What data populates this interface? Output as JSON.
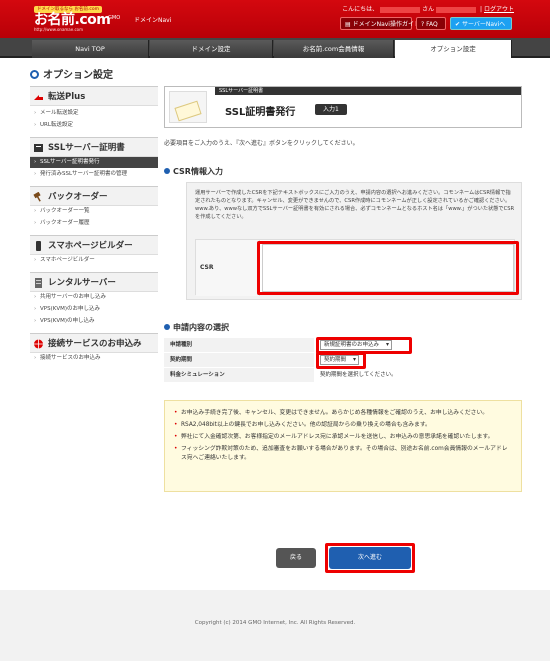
{
  "header": {
    "logo_tag": "ドメイン取るなら お名前.com",
    "logo_text": "お名前.com",
    "logo_url": "http://www.onamae.com",
    "gmo_label": "GMO",
    "site_name": "ドメインNavi",
    "greeting_prefix": "こんにちは、",
    "greeting_suffix": "さん",
    "logout": "ログアウト",
    "guide_button": "ドメインNavi操作ガイド",
    "faq_button": "FAQ",
    "twitter_button": "サーバーNaviへ"
  },
  "tabs": [
    {
      "label": "Navi TOP",
      "active": false
    },
    {
      "label": "ドメイン設定",
      "active": false
    },
    {
      "label": "お名前.com会員情報",
      "active": false
    },
    {
      "label": "オプション設定",
      "active": true
    }
  ],
  "page_title": "オプション設定",
  "sidebar": {
    "sections": [
      {
        "title": "転送Plus",
        "icon": "arrow-icon",
        "items": [
          "メール転送設定",
          "URL転送設定"
        ]
      },
      {
        "title": "SSLサーバー証明書",
        "icon": "ssl-icon",
        "items": [
          "SSLサーバー証明書発行",
          "発行済みSSLサーバー証明書の管理"
        ]
      },
      {
        "title": "バックオーダー",
        "icon": "gavel-icon",
        "items": [
          "バックオーダー一覧",
          "バックオーダー履歴"
        ]
      },
      {
        "title": "スマホページビルダー",
        "icon": "smartphone-icon",
        "items": [
          "スマホページビルダー"
        ]
      },
      {
        "title": "レンタルサーバー",
        "icon": "server-icon",
        "items": [
          "共用サーバーのお申し込み",
          "VPS(KVM)のお申し込み",
          "VPS(KVM)の申し込み"
        ]
      },
      {
        "title": "接続サービスのお申込み",
        "icon": "globe-icon",
        "items": [
          "接続サービスのお申込み"
        ]
      }
    ]
  },
  "banner": {
    "category": "SSLサーバー証明書",
    "title": "SSL証明書発行",
    "step_badge": "入力1"
  },
  "intro": "必要項目をご入力のうえ、『次へ進む』ボタンをクリックしてください。",
  "csr": {
    "section_title": "CSR情報入力",
    "description": "運用サーバーで作成したCSRを下記テキストボックスにご入力のうえ、申請内容の選択へお進みください。コモンネームはCSR情報で指定されたものとなります。キャンセル、変更ができませんので、CSR作成時にコモンネームが正しく設定されているかご確認ください。www.あり、wwwなし双方でSSLサーバー証明書を有効にされる場合、必ずコモンネームとなるホスト名は「www.」がついた状態でCSRを作成してください。",
    "field_label": "CSR",
    "textarea_value": ""
  },
  "application": {
    "section_title": "申請内容の選択",
    "rows": [
      {
        "label": "申請種別",
        "value": "新規証明書のお申込み",
        "type": "select"
      },
      {
        "label": "契約期間",
        "value": "契約期間",
        "type": "select"
      },
      {
        "label": "料金シミュレーション",
        "value": "契約期間を選択してください。",
        "type": "text"
      }
    ]
  },
  "notices": [
    "お申込み手続き完了後、キャンセル、変更はできません。あらかじめ各種情報をご確認のうえ、お申し込みください。",
    "RSA2,048bit以上の鍵長でお申し込みください。他の認証局からの乗り換えの場合も含みます。",
    "弊社にて入金確認次第、お客様指定のメールアドレス宛に承認メールを送信し、お申込みの意思承諾を確認いたします。",
    "フィッシング詐欺対策のため、追加審査をお願いする場合があります。その場合は、別途お名前.com会員情報のメールアドレス宛へご連絡いたします。"
  ],
  "buttons": {
    "back": "戻る",
    "next": "次へ進む"
  },
  "footer": {
    "copyright": "Copyright (c) 2014 GMO Internet, Inc. All Rights Reserved."
  },
  "colors": {
    "brand_red": "#c4000a",
    "accent_blue": "#1f5fb0",
    "highlight_red": "#ee0000"
  }
}
